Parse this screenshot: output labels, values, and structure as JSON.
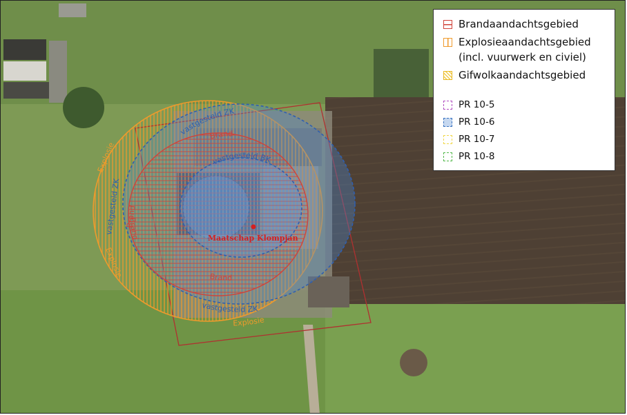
{
  "legend": {
    "items": [
      {
        "label": "Brandaandachtsgebied",
        "color": "#d0433a"
      },
      {
        "label": "Explosieaandachtsgebied",
        "color": "#ef9a2c"
      },
      {
        "label": "(incl. vuurwerk en civiel)"
      },
      {
        "label": "Gifwolkaandachtsgebied",
        "color": "#e8b820"
      }
    ],
    "pr_items": [
      {
        "label": "PR 10-5",
        "color": "#b04cc0"
      },
      {
        "label": "PR 10-6",
        "color": "#3a73c0"
      },
      {
        "label": "PR 10-7",
        "color": "#f0d84a"
      },
      {
        "label": "PR 10-8",
        "color": "#52b84a"
      }
    ]
  },
  "map": {
    "site_label": "Maatschap Klompjan",
    "ring_labels": {
      "zk_top": "vastgesteld ZK",
      "zk_left": "vastgesteld ZK",
      "zk_bottom": "vastgesteld ZK",
      "bk": "vastgesteld BK",
      "brand_top": "Brand",
      "brand_left": "Brand",
      "brand_left2": "Brand",
      "brand_bottom": "Brand",
      "explosie_left": "Explosie",
      "explosie_left2": "Explosie",
      "explosie_bottom": "Explosie"
    },
    "colors": {
      "brand": "#d0433a",
      "explosie": "#ef9a2c",
      "zk": "#2f5fb0",
      "site_marker": "#d42020",
      "parcel": "#b03030"
    }
  }
}
